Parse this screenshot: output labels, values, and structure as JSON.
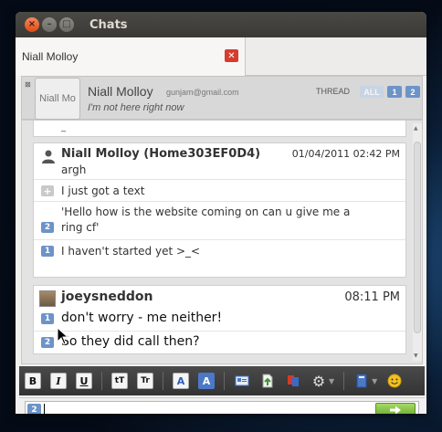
{
  "window": {
    "title": "Chats"
  },
  "tab": {
    "label": "Niall Molloy"
  },
  "header": {
    "avatar_text": "Niall Mo",
    "name": "Niall Molloy",
    "email": "gunjam@gmail.com",
    "status": "I'm not here right now",
    "thread_label": "THREAD",
    "thread_all": "ALL",
    "thread_1": "1",
    "thread_2": "2"
  },
  "messages": {
    "prev_tail": "_",
    "block1": {
      "sender": "Niall Molloy (Home303EF0D4)",
      "time": "01/04/2011 02:42 PM",
      "first": "argh",
      "lines": [
        {
          "badge": "+",
          "text": "I just got a text"
        },
        {
          "badge": "2",
          "text": "'Hello how is the website coming on can u give me a"
        },
        {
          "badge": "",
          "text": "ring cf'"
        },
        {
          "badge": "1",
          "text": "I haven't started yet >_<"
        }
      ]
    },
    "block2": {
      "sender": "joeysneddon",
      "time": "08:11 PM",
      "lines": [
        {
          "badge": "1",
          "text": "don't worry - me neither!"
        },
        {
          "badge": "2",
          "text": "So they did call then?"
        }
      ]
    }
  },
  "toolbar": {
    "bold": "B",
    "italic": "I",
    "underline": "U",
    "size_small": "tT",
    "size_big": "Tr",
    "font_color": "A",
    "bg_color": "A"
  },
  "input": {
    "thread_badge": "2",
    "value": "",
    "send_icon": "arrow-right-icon"
  }
}
